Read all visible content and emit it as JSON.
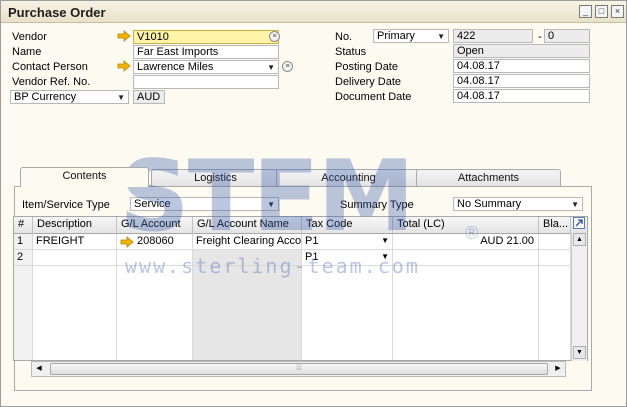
{
  "window": {
    "title": "Purchase Order",
    "controls": [
      "_",
      "□",
      "×"
    ]
  },
  "header_left": {
    "vendor_label": "Vendor",
    "vendor_value": "V1010",
    "name_label": "Name",
    "name_value": "Far East Imports",
    "contact_label": "Contact Person",
    "contact_value": "Lawrence Miles",
    "vendor_ref_label": "Vendor Ref. No.",
    "vendor_ref_value": "",
    "currency_select": "BP Currency",
    "currency_value": "AUD"
  },
  "header_right": {
    "no_label": "No.",
    "series_value": "Primary",
    "doc_number": "422",
    "doc_suffix_sep": "-",
    "doc_suffix": "0",
    "status_label": "Status",
    "status_value": "Open",
    "posting_label": "Posting Date",
    "posting_value": "04.08.17",
    "delivery_label": "Delivery Date",
    "delivery_value": "04.08.17",
    "document_label": "Document Date",
    "document_value": "04.08.17"
  },
  "tabs": [
    {
      "label": "Contents",
      "active": true
    },
    {
      "label": "Logistics",
      "active": false
    },
    {
      "label": "Accounting",
      "active": false
    },
    {
      "label": "Attachments",
      "active": false
    }
  ],
  "contents": {
    "item_type_label": "Item/Service Type",
    "item_type_value": "Service",
    "summary_label": "Summary Type",
    "summary_value": "No Summary"
  },
  "grid": {
    "columns": [
      "#",
      "Description",
      "G/L Account",
      "G/L Account Name",
      "Tax Code",
      "Total (LC)",
      "Bla..."
    ],
    "rows": [
      {
        "num": "1",
        "description": "FREIGHT",
        "gl_account": "208060",
        "gl_name": "Freight Clearing Accour",
        "tax_code": "P1",
        "total": "AUD 21.00"
      },
      {
        "num": "2",
        "description": "",
        "gl_account": "",
        "gl_name": "",
        "tax_code": "P1",
        "total": ""
      }
    ]
  },
  "watermark": {
    "logo_text": "STEM",
    "url_text": "www.sterling-team.com",
    "registered": "®"
  },
  "colors": {
    "accent_yellow": "#fff3a8",
    "link_arrow": "#f0b400",
    "watermark": "#3c5ea8"
  }
}
